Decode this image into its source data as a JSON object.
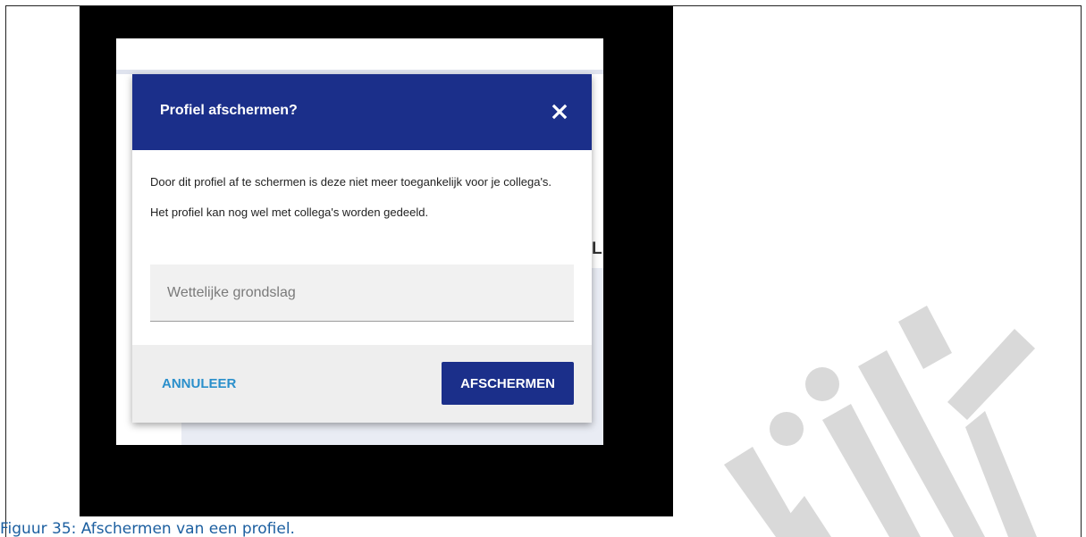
{
  "dialog": {
    "title": "Profiel afschermen?",
    "close_icon": "close-icon",
    "body_line1": "Door dit profiel af te schermen is deze niet meer toegankelijk voor je collega's.",
    "body_line2": "Het profiel kan nog wel met collega's worden gedeeld.",
    "field_placeholder": "Wettelijke grondslag",
    "field_value": "",
    "cancel_label": "ANNULEER",
    "confirm_label": "AFSCHERMEN"
  },
  "background_app": {
    "partial_text": "L"
  },
  "caption": "Figuur 35: Afschermen van een profiel.",
  "colors": {
    "header": "#1b2f8a",
    "confirm_button": "#1b2f8a",
    "cancel_text": "#2a8fcb",
    "caption_text": "#1c5fa0",
    "watermark": "#d9d9d9"
  }
}
